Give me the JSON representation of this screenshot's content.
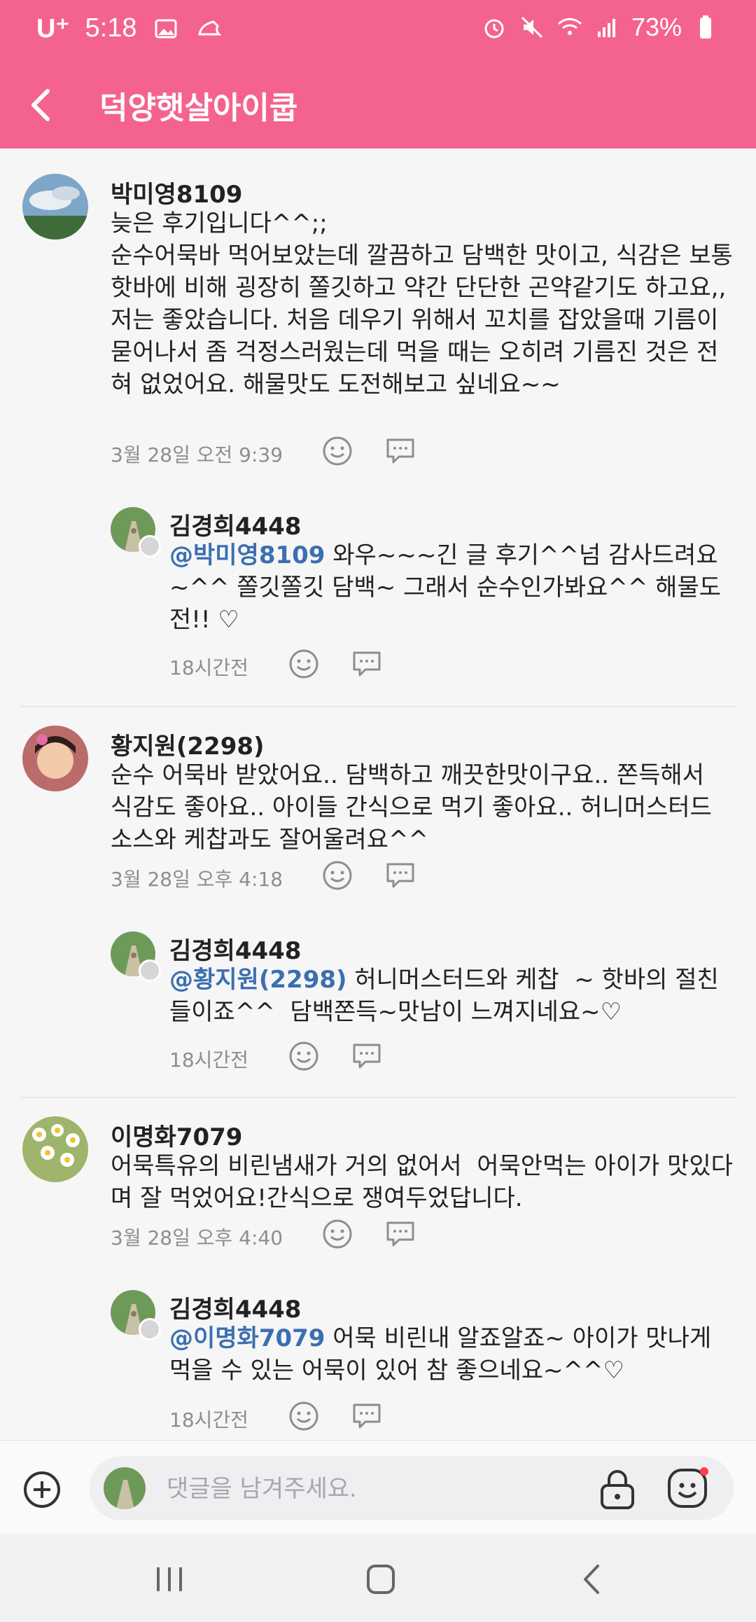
{
  "status": {
    "carrier": "U⁺",
    "time": "5:18",
    "battery": "73%"
  },
  "appbar": {
    "title": "덕양햇살아이쿱"
  },
  "comments": [
    {
      "author": "박미영8109",
      "text": "늦은 후기입니다^^;;\n순수어묵바 먹어보았는데 깔끔하고 담백한 맛이고, 식감은 보통 핫바에 비해 굉장히 쫄깃하고 약간 단단한 곤약같기도 하고요,, 저는 좋았습니다. 처음 데우기 위해서 꼬치를 잡았을때 기름이 묻어나서 좀 걱정스러웠는데 먹을 때는 오히려 기름진 것은 전혀 없었어요. 해물맛도 도전해보고 싶네요~~",
      "time": "3월 28일 오전 9:39",
      "reply": {
        "author": "김경희4448",
        "mention": "@박미영8109",
        "text": " 와우~~~긴 글 후기^^넘 감사드려요~^^ 쫄깃쫄깃 담백~ 그래서 순수인가봐요^^ 해물도전!! ♡",
        "time": "18시간전"
      }
    },
    {
      "author": "황지원(2298)",
      "text": "순수 어묵바 받았어요.. 담백하고 깨끗한맛이구요.. 쫀득해서 식감도 좋아요.. 아이들 간식으로 먹기 좋아요.. 허니머스터드 소스와 케찹과도 잘어울려요^^",
      "time": "3월 28일 오후 4:18",
      "reply": {
        "author": "김경희4448",
        "mention": "@황지원(2298)",
        "text": " 허니머스터드와 케찹  ~ 핫바의 절친들이죠^^  담백쫀득~맛남이 느껴지네요~♡",
        "time": "18시간전"
      }
    },
    {
      "author": "이명화7079",
      "text": "어묵특유의 비린냄새가 거의 없어서  어묵안먹는 아이가 맛있다며 잘 먹었어요!간식으로 쟁여두었답니다.",
      "time": "3월 28일 오후 4:40",
      "reply": {
        "author": "김경희4448",
        "mention": "@이명화7079",
        "text": " 어묵 비린내 알죠알죠~ 아이가 맛나게 먹을 수 있는 어묵이 있어 참 좋으네요~^^♡",
        "time": "18시간전"
      }
    }
  ],
  "composer": {
    "placeholder": "댓글을 남겨주세요."
  },
  "icons": {
    "back": "chevron-left-icon",
    "plus": "plus-circle-icon",
    "lock": "lock-icon",
    "emoji": "emoji-icon",
    "smile": "smile-icon",
    "reply": "reply-bubble-icon"
  },
  "colors": {
    "brand": "#f4638f",
    "mention": "#3b6fb0",
    "meta": "#8d8d92"
  }
}
